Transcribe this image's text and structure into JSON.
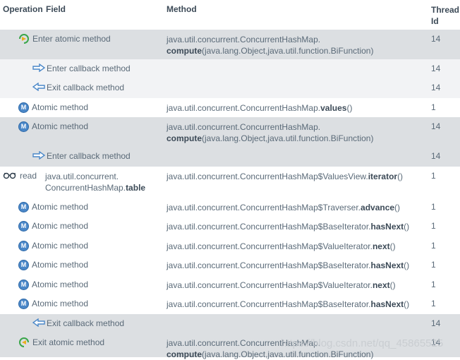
{
  "headers": {
    "operation": "Operation",
    "field": "Field",
    "method": "Method",
    "thread_id_line1": "Thread",
    "thread_id_line2": "Id"
  },
  "rows": [
    {
      "op_label": "Enter atomic method",
      "icon": "enter-atomic-icon",
      "method_pre": "java.util.concurrent.ConcurrentHashMap.",
      "method_name": "compute",
      "method_post": "(java.lang.Object,java.util.function.BiFunction)",
      "thread": "14"
    },
    {
      "op_label": "Enter callback method",
      "icon": "enter-callback-icon",
      "thread": "14"
    },
    {
      "op_label": "Exit callback method",
      "icon": "exit-callback-icon",
      "thread": "14"
    },
    {
      "op_label": "Atomic method",
      "icon": "atomic-method-icon",
      "method_pre": "java.util.concurrent.ConcurrentHashMap.",
      "method_name": "values",
      "method_post": "()",
      "thread": "1"
    },
    {
      "op_label": "Atomic method",
      "icon": "atomic-method-icon",
      "method_pre": "java.util.concurrent.ConcurrentHashMap.",
      "method_name": "compute",
      "method_post": "(java.lang.Object,java.util.function.BiFunction)",
      "thread": "14"
    },
    {
      "op_label": "Enter callback method",
      "icon": "enter-callback-icon",
      "thread": "14"
    },
    {
      "op_label": "read",
      "icon": "read-glasses-icon",
      "field_pre": "java.util.concurrent.",
      "field_pre2": "ConcurrentHashMap.",
      "field_name": "table",
      "method_pre": "java.util.concurrent.ConcurrentHashMap$ValuesView.",
      "method_name": "iterator",
      "method_post": "()",
      "thread": "1"
    },
    {
      "op_label": "Atomic method",
      "icon": "atomic-method-icon",
      "method_pre": "java.util.concurrent.ConcurrentHashMap$Traverser.",
      "method_name": "advance",
      "method_post": "()",
      "thread": "1"
    },
    {
      "op_label": "Atomic method",
      "icon": "atomic-method-icon",
      "method_pre": "java.util.concurrent.ConcurrentHashMap$BaseIterator.",
      "method_name": "hasNext",
      "method_post": "()",
      "thread": "1"
    },
    {
      "op_label": "Atomic method",
      "icon": "atomic-method-icon",
      "method_pre": "java.util.concurrent.ConcurrentHashMap$ValueIterator.",
      "method_name": "next",
      "method_post": "()",
      "thread": "1"
    },
    {
      "op_label": "Atomic method",
      "icon": "atomic-method-icon",
      "method_pre": "java.util.concurrent.ConcurrentHashMap$BaseIterator.",
      "method_name": "hasNext",
      "method_post": "()",
      "thread": "1"
    },
    {
      "op_label": "Atomic method",
      "icon": "atomic-method-icon",
      "method_pre": "java.util.concurrent.ConcurrentHashMap$ValueIterator.",
      "method_name": "next",
      "method_post": "()",
      "thread": "1"
    },
    {
      "op_label": "Atomic method",
      "icon": "atomic-method-icon",
      "method_pre": "java.util.concurrent.ConcurrentHashMap$BaseIterator.",
      "method_name": "hasNext",
      "method_post": "()",
      "thread": "1"
    },
    {
      "op_label": "Exit callback method",
      "icon": "exit-callback-icon",
      "thread": "14"
    },
    {
      "op_label": "Exit atomic method",
      "icon": "exit-atomic-icon",
      "method_pre": "java.util.concurrent.ConcurrentHashMap.",
      "method_name": "compute",
      "method_post": "(java.lang.Object,java.util.function.BiFunction)",
      "thread": "14"
    }
  ],
  "badge_letter": "M",
  "watermark": "https://blog.csdn.net/qq_45865525",
  "colors": {
    "shaded": "#dcdfe2",
    "light": "#f2f3f5",
    "accent": "#4a87c8",
    "green": "#3aa64a"
  }
}
